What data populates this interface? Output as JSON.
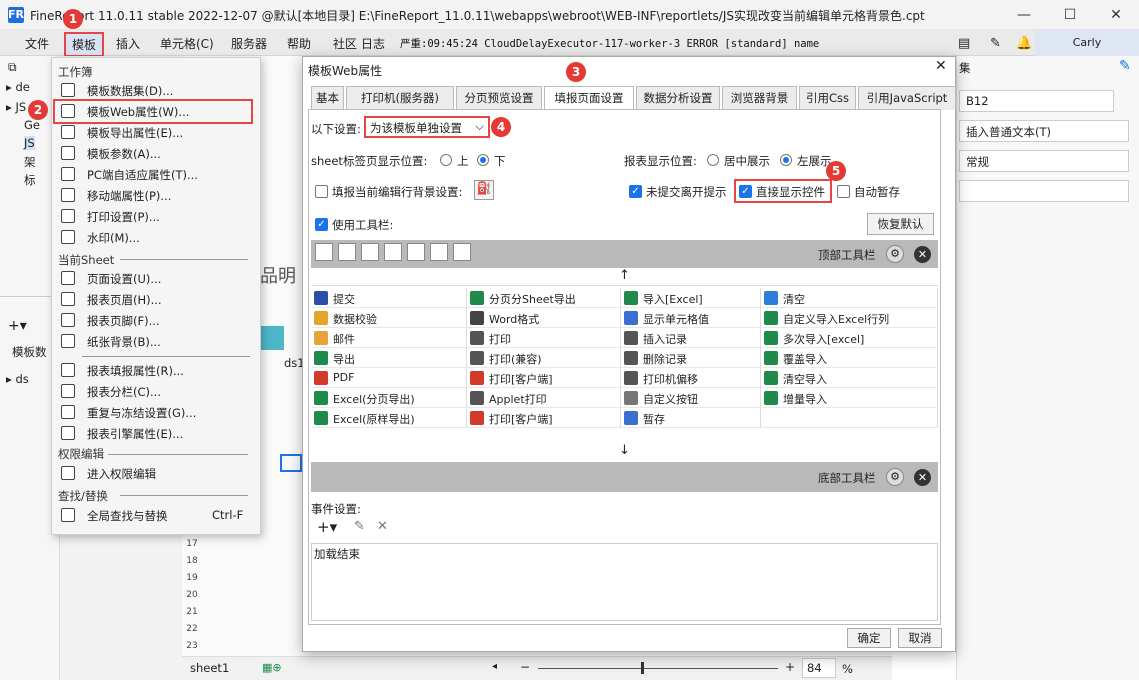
{
  "window": {
    "title": "FineReport 11.0.11 stable 2022-12-07 @默认[本地目录]    E:\\FineReport_11.0.11\\webapps\\webroot\\WEB-INF\\reportlets/JS实现改变当前编辑单元格背景色.cpt",
    "logo": "FR"
  },
  "menubar": {
    "items": [
      "文件",
      "模板",
      "插入",
      "单元格(C)",
      "服务器",
      "帮助",
      "社区",
      "日志"
    ],
    "error_text": "严重:09:45:24 CloudDelayExecutor-117-worker-3 ERROR [standard] name",
    "user": "Carly"
  },
  "badges": [
    "1",
    "2",
    "3",
    "4",
    "5"
  ],
  "dropdown": {
    "group_workbook": "工作簿",
    "workbook_items": [
      {
        "label": "模板数据集(D)...",
        "icon": "database-icon"
      },
      {
        "label": "模板Web属性(W)...",
        "icon": "globe-icon"
      },
      {
        "label": "模板导出属性(E)...",
        "icon": "export-icon"
      },
      {
        "label": "模板参数(A)...",
        "icon": "parameter-icon"
      },
      {
        "label": "PC端自适应属性(T)...",
        "icon": "pc-adapt-icon"
      },
      {
        "label": "移动端属性(P)...",
        "icon": "mobile-icon"
      },
      {
        "label": "打印设置(P)...",
        "icon": "printer-icon"
      },
      {
        "label": "水印(M)...",
        "icon": "watermark-icon"
      }
    ],
    "group_sheet": "当前Sheet",
    "sheet_items": [
      {
        "label": "页面设置(U)...",
        "icon": "page-setup-icon"
      },
      {
        "label": "报表页眉(H)...",
        "icon": "header-icon"
      },
      {
        "label": "报表页脚(F)...",
        "icon": "footer-icon"
      },
      {
        "label": "纸张背景(B)...",
        "icon": "background-icon"
      }
    ],
    "sheet_items2": [
      {
        "label": "报表填报属性(R)...",
        "icon": "fill-attr-icon"
      },
      {
        "label": "报表分栏(C)...",
        "icon": "columns-icon"
      },
      {
        "label": "重复与冻结设置(G)...",
        "icon": "freeze-icon"
      },
      {
        "label": "报表引擎属性(E)...",
        "icon": "engine-icon"
      }
    ],
    "group_perm": "权限编辑",
    "perm_items": [
      {
        "label": "进入权限编辑",
        "icon": "permission-icon"
      }
    ],
    "group_find": "查找/替换",
    "find_items": [
      {
        "label": "全局查找与替换",
        "shortcut": "Ctrl-F",
        "icon": "search-icon"
      }
    ]
  },
  "dialog": {
    "title": "模板Web属性",
    "tabs": [
      "基本",
      "打印机(服务器)",
      "分页预览设置",
      "填报页面设置",
      "数据分析设置",
      "浏览器背景",
      "引用Css",
      "引用JavaScript"
    ],
    "active_tab": 3,
    "settings_label": "以下设置:",
    "settings_value": "为该模板单独设置",
    "sheet_tab_pos_label": "sheet标签页显示位置:",
    "sheet_tab_up": "上",
    "sheet_tab_down": "下",
    "report_pos_label": "报表显示位置:",
    "report_pos_center": "居中展示",
    "report_pos_left": "左展示",
    "fill_bg_label": "填报当前编辑行背景设置:",
    "unsubmit_label": "未提交离开提示",
    "direct_widget_label": "直接显示控件",
    "auto_save_label": "自动暂存",
    "use_toolbar_label": "使用工具栏:",
    "restore_label": "恢复默认",
    "top_toolbar_label": "顶部工具栏",
    "bottom_toolbar_label": "底部工具栏",
    "top_toolbar_icons": [
      "save-icon",
      "verify-icon",
      "print-icon",
      "export-icon",
      "mail-icon",
      "insert-row-icon",
      "show-cell-icon"
    ],
    "grid": [
      [
        {
          "label": "提交",
          "color": "#2b4fa8"
        },
        {
          "label": "分页分Sheet导出",
          "color": "#1e8a4c"
        },
        {
          "label": "导入[Excel]",
          "color": "#1e8a4c"
        },
        {
          "label": "清空",
          "color": "#2b7fd8"
        }
      ],
      [
        {
          "label": "数据校验",
          "color": "#e0a52a"
        },
        {
          "label": "Word格式",
          "color": "#444"
        },
        {
          "label": "显示单元格值",
          "color": "#3a6fd1"
        },
        {
          "label": "自定义导入Excel行列",
          "color": "#1e8a4c"
        }
      ],
      [
        {
          "label": "邮件",
          "color": "#e8a23a"
        },
        {
          "label": "打印",
          "color": "#555"
        },
        {
          "label": "插入记录",
          "color": "#555"
        },
        {
          "label": "多次导入[excel]",
          "color": "#1e8a4c"
        }
      ],
      [
        {
          "label": "导出",
          "color": "#1e8a4c"
        },
        {
          "label": "打印(兼容)",
          "color": "#555"
        },
        {
          "label": "删除记录",
          "color": "#555"
        },
        {
          "label": "覆盖导入",
          "color": "#1e8a4c"
        }
      ],
      [
        {
          "label": "PDF",
          "color": "#d23b2b"
        },
        {
          "label": "打印[客户端]",
          "color": "#d23b2b"
        },
        {
          "label": "打印机偏移",
          "color": "#555"
        },
        {
          "label": "清空导入",
          "color": "#1e8a4c"
        }
      ],
      [
        {
          "label": "Excel(分页导出)",
          "color": "#1e8a4c"
        },
        {
          "label": "Applet打印",
          "color": "#555"
        },
        {
          "label": "自定义按钮",
          "color": "#777"
        },
        {
          "label": "增量导入",
          "color": "#1e8a4c"
        }
      ],
      [
        {
          "label": "Excel(原样导出)",
          "color": "#1e8a4c"
        },
        {
          "label": "打印[客户端]",
          "color": "#d23b2b"
        },
        {
          "label": "暂存",
          "color": "#3a6fd1"
        },
        {
          "label": "",
          "color": ""
        }
      ]
    ],
    "event_label": "事件设置:",
    "event_item": "加载结束",
    "ok": "确定",
    "cancel": "取消"
  },
  "background": {
    "tree_items": [
      "de",
      "JS",
      "Ge",
      "JS",
      "架",
      "标"
    ],
    "dataset_label": "模板数",
    "ds_item": "ds",
    "sheet_text": "品明",
    "cell_text": "ds1",
    "rows": [
      "17",
      "18",
      "19",
      "20",
      "21",
      "22",
      "23"
    ],
    "sheet_tab": "sheet1",
    "zoom": "84",
    "zoom_unit": "%",
    "right_cell": "B12",
    "right_insert": "插入普通文本(T)",
    "right_format": "常规",
    "right_header": "集"
  }
}
